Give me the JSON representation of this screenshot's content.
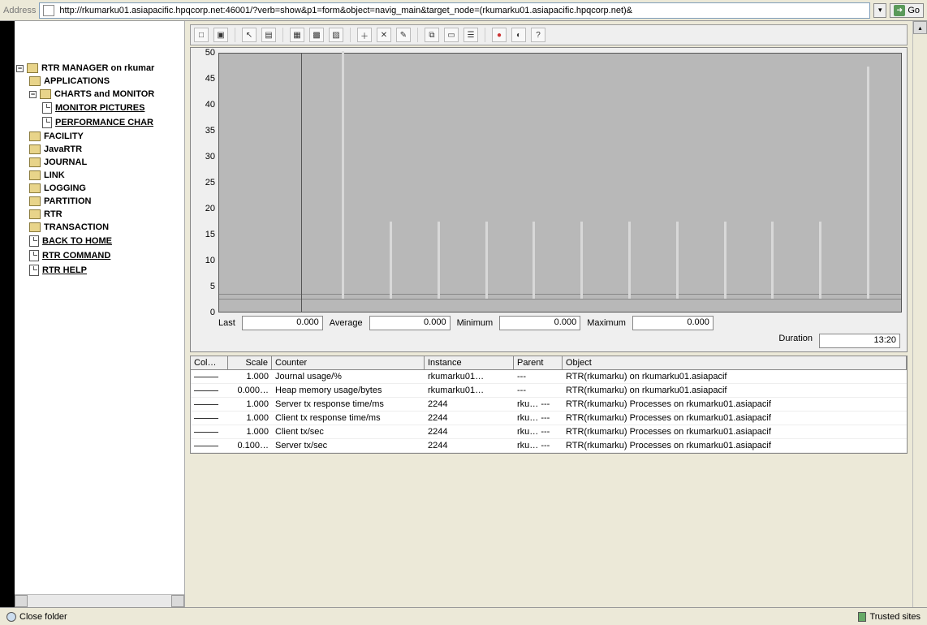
{
  "address": {
    "label": "Address",
    "url": "http://rkumarku01.asiapacific.hpqcorp.net:46001/?verb=show&p1=form&object=navig_main&target_node=(rkumarku01.asiapacific.hpqcorp.net)&",
    "go": "Go"
  },
  "sidebar": {
    "root": "RTR MANAGER on rkumar",
    "items": [
      {
        "label": "APPLICATIONS",
        "link": false
      },
      {
        "label": "CHARTS and MONITOR",
        "link": false,
        "expanded": true,
        "children": [
          {
            "label": "MONITOR PICTURES",
            "link": true
          },
          {
            "label": "PERFORMANCE CHAR",
            "link": true
          }
        ]
      },
      {
        "label": "FACILITY",
        "link": false
      },
      {
        "label": "JavaRTR",
        "link": false
      },
      {
        "label": "JOURNAL",
        "link": false
      },
      {
        "label": "LINK",
        "link": false
      },
      {
        "label": "LOGGING",
        "link": false
      },
      {
        "label": "PARTITION",
        "link": false
      },
      {
        "label": "RTR",
        "link": false
      },
      {
        "label": "TRANSACTION",
        "link": false
      },
      {
        "label": "BACK TO HOME",
        "link": true
      },
      {
        "label": "RTR COMMAND",
        "link": true
      },
      {
        "label": "RTR HELP",
        "link": true
      }
    ]
  },
  "stats": {
    "last_label": "Last",
    "last": "0.000",
    "avg_label": "Average",
    "avg": "0.000",
    "min_label": "Minimum",
    "min": "0.000",
    "max_label": "Maximum",
    "max": "0.000",
    "dur_label": "Duration",
    "dur": "13:20"
  },
  "table": {
    "headers": [
      "Col…",
      "Scale",
      "Counter",
      "Instance",
      "Parent",
      "Object"
    ],
    "rows": [
      {
        "scale": "1.000",
        "counter": "Journal usage/%",
        "instance": "rkumarku01…",
        "parent": "---",
        "object": "RTR(rkumarku) on rkumarku01.asiapacif"
      },
      {
        "scale": "0.000…",
        "counter": "Heap memory usage/bytes",
        "instance": "rkumarku01…",
        "parent": "---",
        "object": "RTR(rkumarku) on rkumarku01.asiapacif"
      },
      {
        "scale": "1.000",
        "counter": "Server tx response time/ms",
        "instance": "2244",
        "parent": "rku…   ---",
        "object": "RTR(rkumarku) Processes on rkumarku01.asiapacif"
      },
      {
        "scale": "1.000",
        "counter": "Client tx response time/ms",
        "instance": "2244",
        "parent": "rku…   ---",
        "object": "RTR(rkumarku) Processes on rkumarku01.asiapacif"
      },
      {
        "scale": "1.000",
        "counter": "Client tx/sec",
        "instance": "2244",
        "parent": "rku…   ---",
        "object": "RTR(rkumarku) Processes on rkumarku01.asiapacif"
      },
      {
        "scale": "0.100…",
        "counter": "Server tx/sec",
        "instance": "2244",
        "parent": "rku…   ---",
        "object": "RTR(rkumarku) Processes on rkumarku01.asiapacif"
      }
    ]
  },
  "chart_data": {
    "type": "line",
    "ylim": [
      0,
      50
    ],
    "yticks": [
      0,
      5,
      10,
      15,
      20,
      25,
      30,
      35,
      40,
      45,
      50
    ],
    "baselines": [
      1,
      2
    ],
    "spikes_x_pct": [
      18,
      25,
      32,
      39,
      46,
      53,
      60,
      67,
      74,
      81,
      88,
      95
    ],
    "spike_heights": [
      48,
      15,
      15,
      15,
      15,
      15,
      15,
      15,
      15,
      15,
      15,
      45
    ]
  },
  "statusbar": {
    "close_folder": "Close folder",
    "trusted": "Trusted sites"
  }
}
